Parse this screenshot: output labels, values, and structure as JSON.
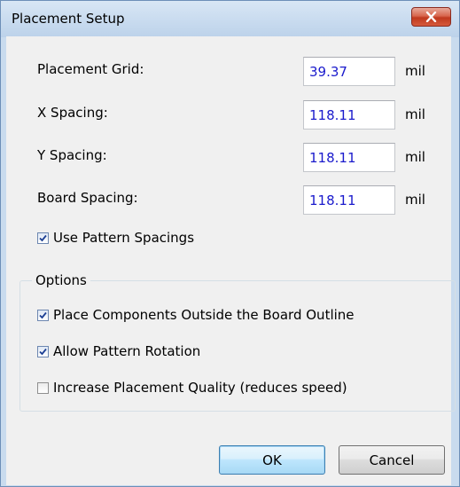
{
  "window": {
    "title": "Placement Setup"
  },
  "fields": [
    {
      "label": "Placement Grid:",
      "value": "39.37",
      "unit": "mil"
    },
    {
      "label": "X Spacing:",
      "value": "118.11",
      "unit": "mil"
    },
    {
      "label": "Y Spacing:",
      "value": "118.11",
      "unit": "mil"
    },
    {
      "label": "Board Spacing:",
      "value": "118.11",
      "unit": "mil"
    }
  ],
  "use_pattern_spacings": {
    "label": "Use Pattern Spacings",
    "checked": true
  },
  "options": {
    "title": "Options",
    "items": [
      {
        "label": "Place Components Outside the Board Outline",
        "checked": true
      },
      {
        "label": "Allow Pattern Rotation",
        "checked": true
      },
      {
        "label": "Increase Placement Quality (reduces speed)",
        "checked": false
      }
    ]
  },
  "buttons": {
    "ok": "OK",
    "cancel": "Cancel"
  },
  "colors": {
    "field_text": "#1a1acc",
    "close_button": "#c7412a",
    "default_button": "#3c7fb1"
  }
}
